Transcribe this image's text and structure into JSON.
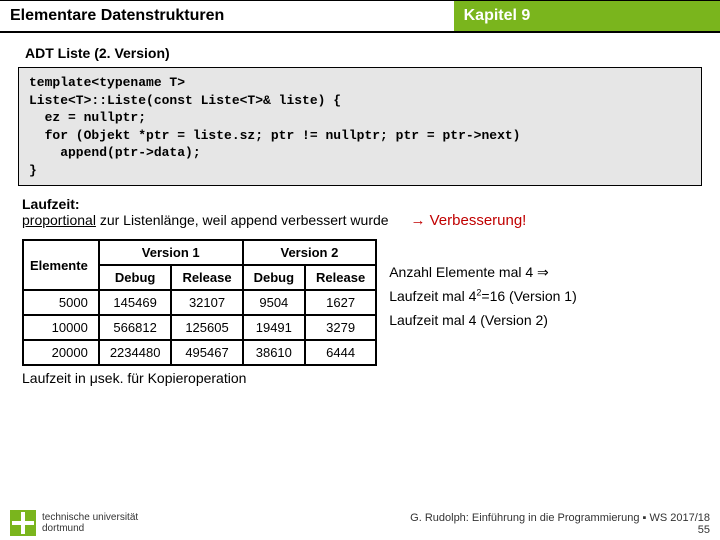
{
  "header": {
    "left": "Elementare Datenstrukturen",
    "right": "Kapitel 9"
  },
  "section_title": "ADT Liste (2. Version)",
  "code": "template<typename T>\nListe<T>::Liste(const Liste<T>& liste) {\n  ez = nullptr;\n  for (Objekt *ptr = liste.sz; ptr != nullptr; ptr = ptr->next)\n    append(ptr->data);\n}",
  "runtime": {
    "label": "Laufzeit:",
    "text_before": "proportional",
    "text_after": " zur Listenlänge, weil append verbessert wurde",
    "improvement": "→ Verbesserung!"
  },
  "table": {
    "group1": "Version 1",
    "group2": "Version 2",
    "col_elem": "Elemente",
    "cols": [
      "Debug",
      "Release",
      "Debug",
      "Release"
    ],
    "rows": [
      {
        "n": "5000",
        "v": [
          "145469",
          "32107",
          "9504",
          "1627"
        ]
      },
      {
        "n": "10000",
        "v": [
          "566812",
          "125605",
          "19491",
          "3279"
        ]
      },
      {
        "n": "20000",
        "v": [
          "2234480",
          "495467",
          "38610",
          "6444"
        ]
      }
    ],
    "caption": "Laufzeit in μsek. für Kopieroperation"
  },
  "sidenotes": {
    "l1": "Anzahl Elemente mal 4 ⇒",
    "l2a": "Laufzeit mal 4",
    "l2b": "=16 (Version 1)",
    "l3": "Laufzeit mal 4 (Version 2)"
  },
  "footer": {
    "uni1": "technische universität",
    "uni2": "dortmund",
    "credit": "G. Rudolph: Einführung in die Programmierung ▪ WS 2017/18",
    "page": "55"
  }
}
